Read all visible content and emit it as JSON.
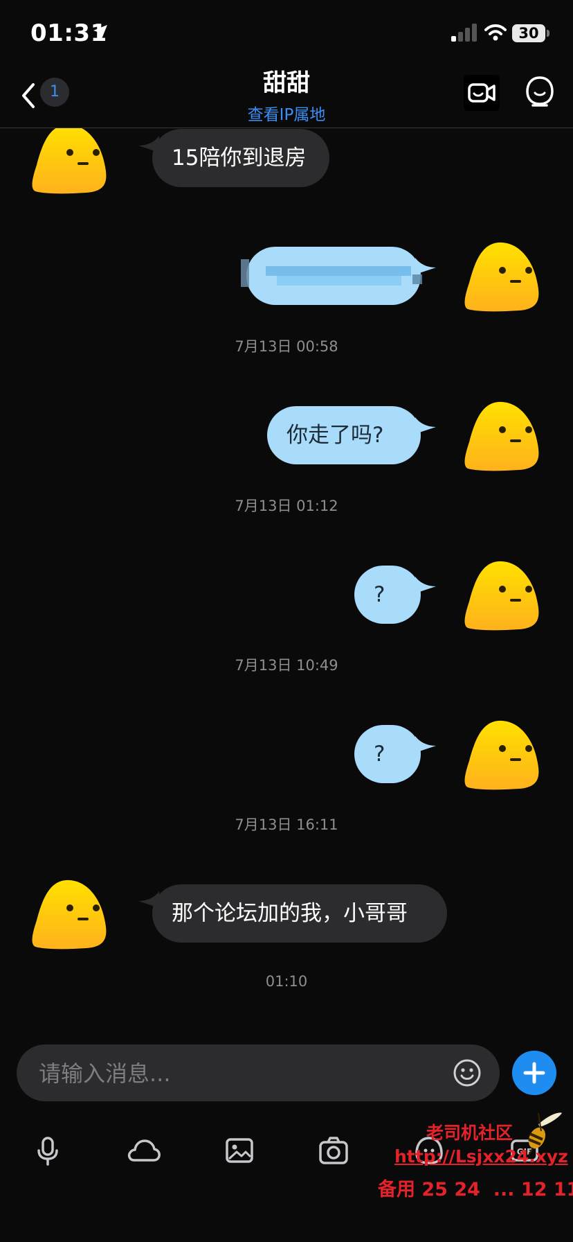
{
  "status_bar": {
    "time": "01:31",
    "battery": "30"
  },
  "header": {
    "unread_count": "1",
    "title": "甜甜",
    "subtitle": "查看IP属地"
  },
  "messages": [
    {
      "side": "in",
      "text": "15陪你到退房"
    },
    {
      "side": "out",
      "text": "",
      "blurred": true
    },
    {
      "type": "timestamp",
      "text": "7月13日 00:58"
    },
    {
      "side": "out",
      "text": "你走了吗?"
    },
    {
      "type": "timestamp",
      "text": "7月13日 01:12"
    },
    {
      "side": "out",
      "text": "?"
    },
    {
      "type": "timestamp",
      "text": "7月13日 10:49"
    },
    {
      "side": "out",
      "text": "?"
    },
    {
      "type": "timestamp",
      "text": "7月13日 16:11"
    },
    {
      "side": "in",
      "text": "那个论坛加的我，小哥哥"
    },
    {
      "type": "timestamp",
      "text": "01:10"
    }
  ],
  "composer": {
    "placeholder": "请输入消息..."
  },
  "toolbar": {
    "icons": [
      "microphone-icon",
      "cloud-icon",
      "image-icon",
      "camera-icon",
      "ghost-icon",
      "gif-icon"
    ]
  },
  "watermark": {
    "line1": "老司机社区",
    "line2": "http://Lsjxx24.xyz",
    "line3": "备用 25 24  ... 12 11"
  },
  "colors": {
    "accent": "#1f8cf2",
    "outgoing_bubble": "#a9dcfb",
    "incoming_bubble": "#2c2c2f",
    "background": "#0a0a0b",
    "watermark": "#e3222a"
  }
}
